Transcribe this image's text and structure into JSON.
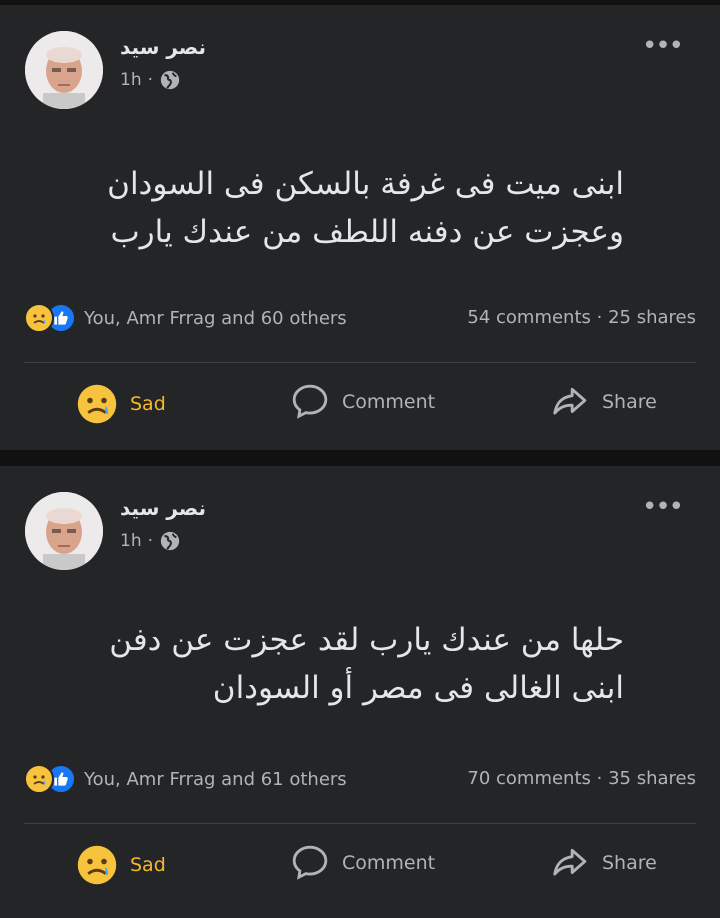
{
  "posts": [
    {
      "author": "نصر سيد",
      "time": "1h",
      "text": "ابنى ميت فى غرفة بالسكن فى السودان\nوعجزت عن دفنه  اللطف من عندك يارب",
      "reactions_text": "You, Amr Frrag and 60 others",
      "comments": "54 comments",
      "shares": "25 shares",
      "actions": {
        "sad": "Sad",
        "comment": "Comment",
        "share": "Share"
      }
    },
    {
      "author": "نصر سيد",
      "time": "1h",
      "text": "حلها من عندك يارب  لقد عجزت عن دفن\nابنى الغالى فى مصر أو السودان",
      "reactions_text": "You, Amr Frrag and 61 others",
      "comments": "70 comments",
      "shares": "35 shares",
      "actions": {
        "sad": "Sad",
        "comment": "Comment",
        "share": "Share"
      }
    }
  ],
  "colors": {
    "background": "#111112",
    "card": "#242526",
    "sad_reaction": "#f7b928",
    "like": "#1877f2"
  },
  "icons": {
    "more": "more-dots-icon",
    "privacy": "globe-icon",
    "sad": "sad-emoji-icon",
    "like": "like-thumb-icon",
    "comment": "comment-bubble-icon",
    "share": "share-arrow-icon"
  }
}
